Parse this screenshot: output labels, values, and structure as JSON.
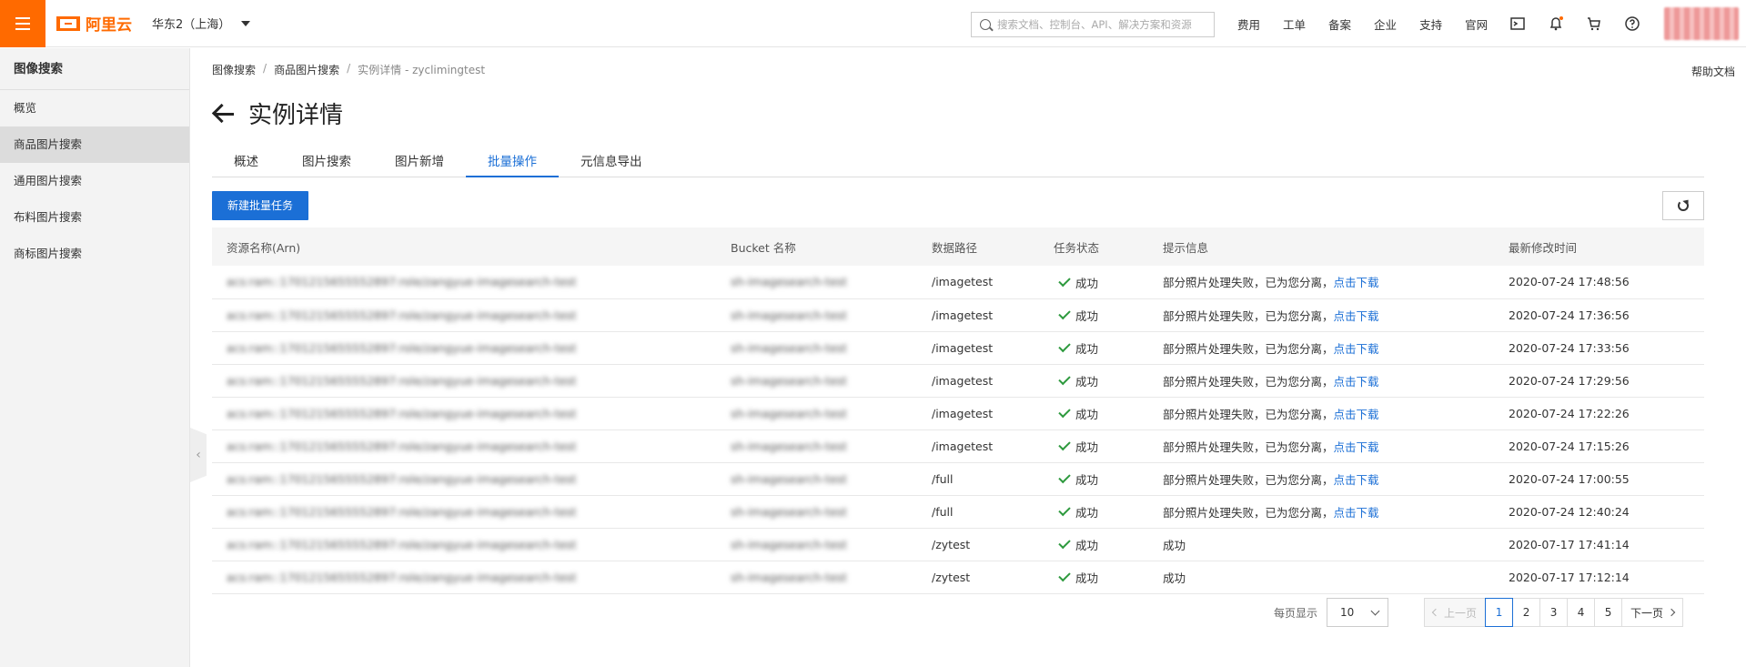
{
  "topbar": {
    "brand": "阿里云",
    "region": "华东2（上海）",
    "search_placeholder": "搜索文档、控制台、API、解决方案和资源",
    "nav": [
      "费用",
      "工单",
      "备案",
      "企业",
      "支持",
      "官网"
    ]
  },
  "sidebar": {
    "title": "图像搜索",
    "items": [
      {
        "label": "概览",
        "active": false
      },
      {
        "label": "商品图片搜索",
        "active": true
      },
      {
        "label": "通用图片搜索",
        "active": false
      },
      {
        "label": "布料图片搜索",
        "active": false
      },
      {
        "label": "商标图片搜索",
        "active": false
      }
    ]
  },
  "breadcrumb": [
    "图像搜索",
    "商品图片搜索",
    "实例详情 - zyclimingtest"
  ],
  "help_doc": "帮助文档",
  "page_title": "实例详情",
  "tabs": [
    {
      "label": "概述",
      "active": false
    },
    {
      "label": "图片搜索",
      "active": false
    },
    {
      "label": "图片新增",
      "active": false
    },
    {
      "label": "批量操作",
      "active": true
    },
    {
      "label": "元信息导出",
      "active": false
    }
  ],
  "create_button": "新建批量任务",
  "table": {
    "columns": [
      "资源名称(Arn)",
      "Bucket 名称",
      "数据路径",
      "任务状态",
      "提示信息",
      "最新修改时间"
    ],
    "rows": [
      {
        "arn": "acs:ram::1701215655552897:role/zangyue-imagesearch-test",
        "bucket": "sh-imagesearch-test",
        "path": "/imagetest",
        "status": "成功",
        "msg": "部分照片处理失败，已为您分离，",
        "link": "点击下载",
        "time": "2020-07-24 17:48:56"
      },
      {
        "arn": "acs:ram::1701215655552897:role/zangyue-imagesearch-test",
        "bucket": "sh-imagesearch-test",
        "path": "/imagetest",
        "status": "成功",
        "msg": "部分照片处理失败，已为您分离，",
        "link": "点击下载",
        "time": "2020-07-24 17:36:56"
      },
      {
        "arn": "acs:ram::1701215655552897:role/zangyue-imagesearch-test",
        "bucket": "sh-imagesearch-test",
        "path": "/imagetest",
        "status": "成功",
        "msg": "部分照片处理失败，已为您分离，",
        "link": "点击下载",
        "time": "2020-07-24 17:33:56"
      },
      {
        "arn": "acs:ram::1701215655552897:role/zangyue-imagesearch-test",
        "bucket": "sh-imagesearch-test",
        "path": "/imagetest",
        "status": "成功",
        "msg": "部分照片处理失败，已为您分离，",
        "link": "点击下载",
        "time": "2020-07-24 17:29:56"
      },
      {
        "arn": "acs:ram::1701215655552897:role/zangyue-imagesearch-test",
        "bucket": "sh-imagesearch-test",
        "path": "/imagetest",
        "status": "成功",
        "msg": "部分照片处理失败，已为您分离，",
        "link": "点击下载",
        "time": "2020-07-24 17:22:26"
      },
      {
        "arn": "acs:ram::1701215655552897:role/zangyue-imagesearch-test",
        "bucket": "sh-imagesearch-test",
        "path": "/imagetest",
        "status": "成功",
        "msg": "部分照片处理失败，已为您分离，",
        "link": "点击下载",
        "time": "2020-07-24 17:15:26"
      },
      {
        "arn": "acs:ram::1701215655552897:role/zangyue-imagesearch-test",
        "bucket": "sh-imagesearch-test",
        "path": "/full",
        "status": "成功",
        "msg": "部分照片处理失败，已为您分离，",
        "link": "点击下载",
        "time": "2020-07-24 17:00:55"
      },
      {
        "arn": "acs:ram::1701215655552897:role/zangyue-imagesearch-test",
        "bucket": "sh-imagesearch-test",
        "path": "/full",
        "status": "成功",
        "msg": "部分照片处理失败，已为您分离，",
        "link": "点击下载",
        "time": "2020-07-24 12:40:24"
      },
      {
        "arn": "acs:ram::1701215655552897:role/zangyue-imagesearch-test",
        "bucket": "sh-imagesearch-test",
        "path": "/zytest",
        "status": "成功",
        "msg": "成功",
        "link": "",
        "time": "2020-07-17 17:41:14"
      },
      {
        "arn": "acs:ram::1701215655552897:role/zangyue-imagesearch-test",
        "bucket": "sh-imagesearch-test",
        "path": "/zytest",
        "status": "成功",
        "msg": "成功",
        "link": "",
        "time": "2020-07-17 17:12:14"
      }
    ]
  },
  "pagination": {
    "page_size_label": "每页显示",
    "page_size": "10",
    "prev": "上一页",
    "next": "下一页",
    "pages": [
      "1",
      "2",
      "3",
      "4",
      "5"
    ],
    "current": "1"
  },
  "colors": {
    "brand": "#ff6a00",
    "primary": "#1b6fd6",
    "success": "#2e9a3e"
  }
}
